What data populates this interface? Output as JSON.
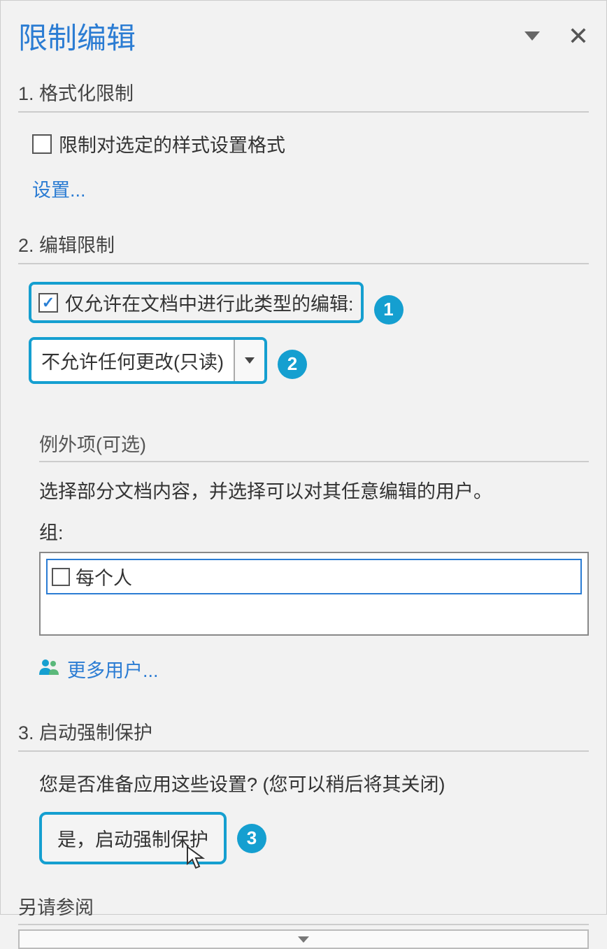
{
  "header": {
    "title": "限制编辑"
  },
  "section1": {
    "title": "1. 格式化限制",
    "checkbox_label": "限制对选定的样式设置格式",
    "settings_link": "设置..."
  },
  "section2": {
    "title": "2. 编辑限制",
    "allow_editing_label": "仅允许在文档中进行此类型的编辑:",
    "dropdown_value": "不允许任何更改(只读)",
    "exceptions": {
      "title": "例外项(可选)",
      "description": "选择部分文档内容，并选择可以对其任意编辑的用户。",
      "group_label": "组:",
      "group_item": "每个人",
      "more_users": "更多用户..."
    }
  },
  "section3": {
    "title": "3. 启动强制保护",
    "apply_question": "您是否准备应用这些设置? (您可以稍后将其关闭)",
    "enforce_button": "是，启动强制保护"
  },
  "see_also": {
    "title": "另请参阅"
  },
  "callouts": {
    "one": "1",
    "two": "2",
    "three": "3"
  }
}
